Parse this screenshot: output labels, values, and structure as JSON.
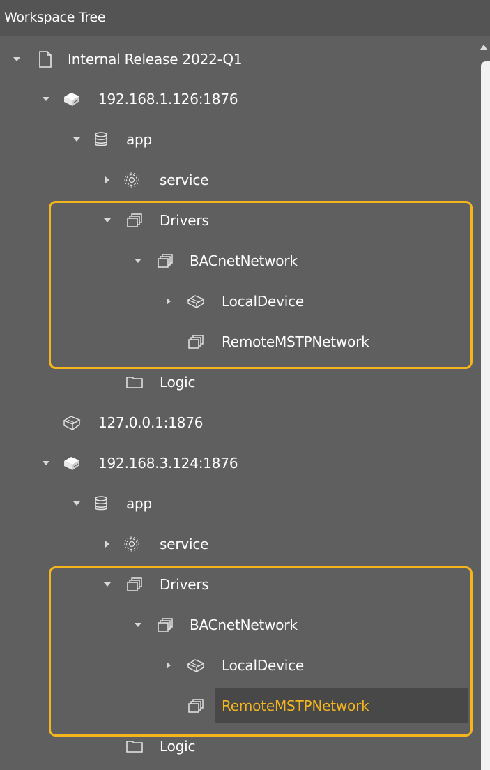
{
  "panel": {
    "title": "Workspace Tree"
  },
  "tree": {
    "items": [
      {
        "label": "Internal Release 2022-Q1",
        "icon": "document-icon",
        "expanded": true
      },
      {
        "label": "192.168.1.126:1876",
        "icon": "server-icon",
        "expanded": true
      },
      {
        "label": "app",
        "icon": "database-icon",
        "expanded": true
      },
      {
        "label": "service",
        "icon": "gear-icon",
        "expanded": false
      },
      {
        "label": "Drivers",
        "icon": "stack-icon",
        "expanded": true
      },
      {
        "label": "BACnetNetwork",
        "icon": "stack-icon",
        "expanded": true
      },
      {
        "label": "LocalDevice",
        "icon": "device-icon",
        "expanded": false
      },
      {
        "label": "RemoteMSTPNetwork",
        "icon": "stack-icon"
      },
      {
        "label": "Logic",
        "icon": "folder-icon"
      },
      {
        "label": "127.0.0.1:1876",
        "icon": "server-outline-icon"
      },
      {
        "label": "192.168.3.124:1876",
        "icon": "server-icon",
        "expanded": true
      },
      {
        "label": "app",
        "icon": "database-icon",
        "expanded": true
      },
      {
        "label": "service",
        "icon": "gear-icon",
        "expanded": false
      },
      {
        "label": "Drivers",
        "icon": "stack-icon",
        "expanded": true
      },
      {
        "label": "BACnetNetwork",
        "icon": "stack-icon",
        "expanded": true
      },
      {
        "label": "LocalDevice",
        "icon": "device-icon",
        "expanded": false
      },
      {
        "label": "RemoteMSTPNetwork",
        "icon": "stack-icon",
        "selected": true
      },
      {
        "label": "Logic",
        "icon": "folder-icon"
      }
    ]
  },
  "colors": {
    "background": "#5f5f5f",
    "header": "#545454",
    "highlight": "#f5b51d",
    "selected_text": "#f5b51d",
    "selected_background": "#484848"
  }
}
